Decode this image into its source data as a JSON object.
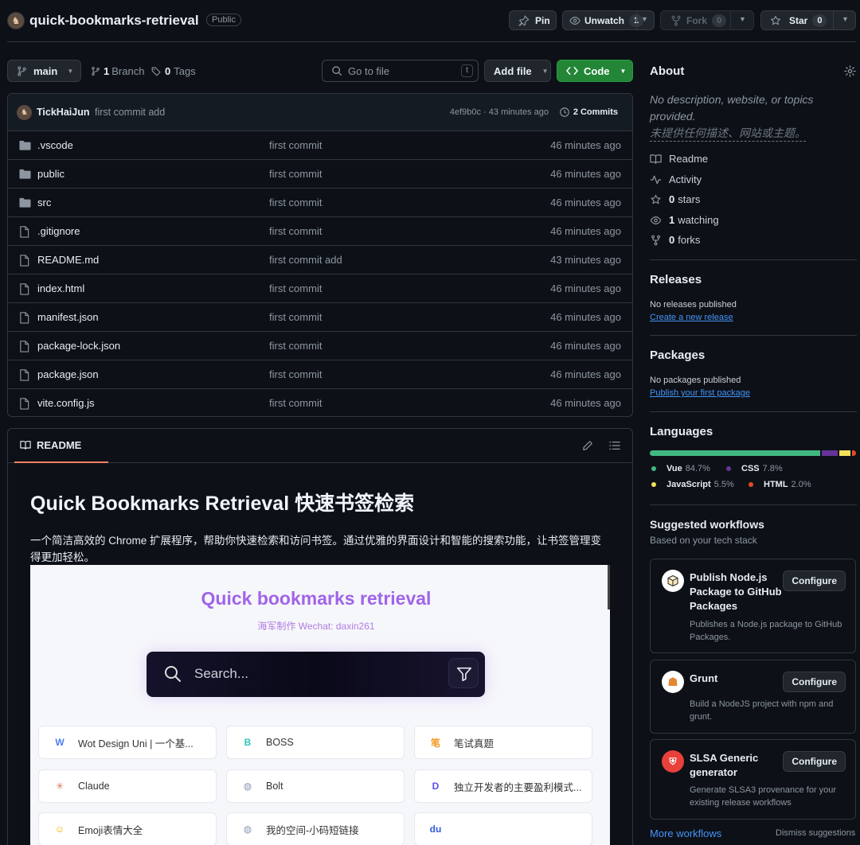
{
  "repo": {
    "name": "quick-bookmarks-retrieval",
    "visibility": "Public"
  },
  "actions": {
    "pin": "Pin",
    "unwatch": "Unwatch",
    "unwatch_count": "1",
    "fork": "Fork",
    "fork_count": "0",
    "star": "Star",
    "star_count": "0"
  },
  "toolbar": {
    "branch": "main",
    "branch_count": "1",
    "branch_label": "Branch",
    "tag_count": "0",
    "tag_label": "Tags",
    "goto_placeholder": "Go to file",
    "goto_shortcut": "t",
    "add_file": "Add file",
    "code": "Code"
  },
  "commit": {
    "author": "TickHaiJun",
    "message": "first commit add",
    "hash_time": "4ef9b0c · 43 minutes ago",
    "commits_count": "2",
    "commits_label": "Commits"
  },
  "files": [
    {
      "name": ".vscode",
      "type": "folder",
      "message": "first commit",
      "time": "46 minutes ago"
    },
    {
      "name": "public",
      "type": "folder",
      "message": "first commit",
      "time": "46 minutes ago"
    },
    {
      "name": "src",
      "type": "folder",
      "message": "first commit",
      "time": "46 minutes ago"
    },
    {
      "name": ".gitignore",
      "type": "file",
      "message": "first commit",
      "time": "46 minutes ago"
    },
    {
      "name": "README.md",
      "type": "file",
      "message": "first commit add",
      "time": "43 minutes ago"
    },
    {
      "name": "index.html",
      "type": "file",
      "message": "first commit",
      "time": "46 minutes ago"
    },
    {
      "name": "manifest.json",
      "type": "file",
      "message": "first commit",
      "time": "46 minutes ago"
    },
    {
      "name": "package-lock.json",
      "type": "file",
      "message": "first commit",
      "time": "46 minutes ago"
    },
    {
      "name": "package.json",
      "type": "file",
      "message": "first commit",
      "time": "46 minutes ago"
    },
    {
      "name": "vite.config.js",
      "type": "file",
      "message": "first commit",
      "time": "46 minutes ago"
    }
  ],
  "readme": {
    "tab": "README",
    "title": "Quick Bookmarks Retrieval 快速书签检索",
    "intro": "一个简洁高效的 Chrome 扩展程序，帮助你快速检索和访问书签。通过优雅的界面设计和智能的搜索功能，让书签管理变得更加轻松。",
    "shot": {
      "title": "Quick bookmarks retrieval",
      "subtitle": "海军制作 Wechat: daxin261",
      "search_placeholder": "Search...",
      "bookmarks": [
        {
          "label": "Wot Design Uni | 一个基...",
          "icon": "W",
          "color": "#4d80f0"
        },
        {
          "label": "BOSS",
          "icon": "B",
          "color": "#2cc4b8"
        },
        {
          "label": "笔试真题",
          "icon": "笔",
          "color": "#f59a23"
        },
        {
          "label": "Claude",
          "icon": "✳",
          "color": "#d97757"
        },
        {
          "label": "Bolt",
          "icon": "◍",
          "color": "#8a9bb5"
        },
        {
          "label": "独立开发者的主要盈利模式...",
          "icon": "D",
          "color": "#5a4ff0"
        },
        {
          "label": "Emoji表情大全",
          "icon": "☺",
          "color": "#f2b400"
        },
        {
          "label": "我的空间-小码短链接",
          "icon": "◍",
          "color": "#8a9bb5"
        },
        {
          "label": "",
          "icon": "du",
          "color": "#2e5bd9"
        }
      ]
    }
  },
  "about": {
    "heading": "About",
    "desc_en": "No description, website, or topics provided.",
    "desc_zh": "未提供任何描述、网站或主题。",
    "links": [
      {
        "icon": "book-icon",
        "label": "Readme"
      },
      {
        "icon": "pulse-icon",
        "label": "Activity"
      },
      {
        "icon": "star-icon",
        "count": "0",
        "label": "stars"
      },
      {
        "icon": "eye-icon",
        "count": "1",
        "label": "watching"
      },
      {
        "icon": "fork-icon",
        "count": "0",
        "label": "forks"
      }
    ]
  },
  "releases": {
    "heading": "Releases",
    "none": "No releases published",
    "link": "Create a new release"
  },
  "packages": {
    "heading": "Packages",
    "none": "No packages published",
    "link": "Publish your first package"
  },
  "languages": {
    "heading": "Languages",
    "items": [
      {
        "name": "Vue",
        "percent": "84.7%",
        "value": 84.7,
        "color": "#41b883"
      },
      {
        "name": "CSS",
        "percent": "7.8%",
        "value": 7.8,
        "color": "#663399"
      },
      {
        "name": "JavaScript",
        "percent": "5.5%",
        "value": 5.5,
        "color": "#f1e05a"
      },
      {
        "name": "HTML",
        "percent": "2.0%",
        "value": 2.0,
        "color": "#e34c26"
      }
    ]
  },
  "workflows": {
    "heading": "Suggested workflows",
    "subheading": "Based on your tech stack",
    "items": [
      {
        "title": "Publish Node.js Package to GitHub Packages",
        "desc": "Publishes a Node.js package to GitHub Packages.",
        "button": "Configure"
      },
      {
        "title": "Grunt",
        "desc": "Build a NodeJS project with npm and grunt.",
        "button": "Configure"
      },
      {
        "title": "SLSA Generic generator",
        "desc": "Generate SLSA3 provenance for your existing release workflows",
        "button": "Configure"
      }
    ],
    "more": "More workflows",
    "dismiss": "Dismiss suggestions"
  }
}
